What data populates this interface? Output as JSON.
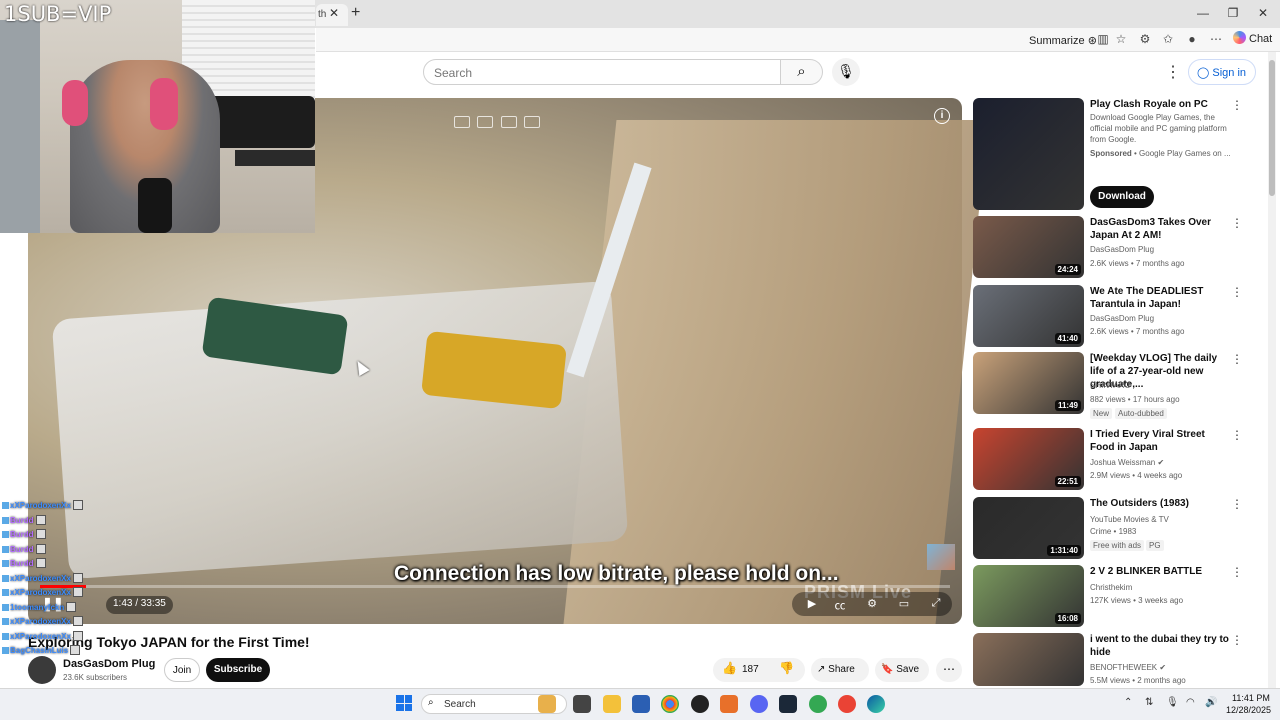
{
  "stream_overlay": {
    "label": "1SUB=VIP"
  },
  "browser": {
    "tab_partial_title": "th",
    "summarize_label": "Summarize",
    "chat_label": "Chat"
  },
  "header": {
    "search_placeholder": "Search",
    "signin_label": "Sign in"
  },
  "player": {
    "subtitle": "Connection has low bitrate, please hold on...",
    "watermark": "PRISM Live",
    "time": "1:43 / 33:35",
    "progress": 0.051
  },
  "video": {
    "title": "Exploring Tokyo JAPAN for the First Time!",
    "channel_name": "DasGasDom Plug",
    "subscribers": "23.6K subscribers",
    "join_label": "Join",
    "subscribe_label": "Subscribe",
    "like_count": "187",
    "share_label": "Share",
    "save_label": "Save"
  },
  "recommendations": [
    {
      "title": "Play Clash Royale on PC",
      "description": "Download Google Play Games, the official mobile and PC gaming platform from Google.",
      "sponsored": "Sponsored",
      "sponsor_channel": "Google Play Games on ...",
      "cta": "Download",
      "thumb_color": "#1b1f2e"
    },
    {
      "title": "DasGasDom3 Takes Over Japan At 2 AM!",
      "channel": "DasGasDom Plug",
      "meta": "2.6K views • 7 months ago",
      "duration": "24:24",
      "thumb_color": "#7a5a4a"
    },
    {
      "title": "We Ate The DEADLIEST Tarantula in Japan!",
      "channel": "DasGasDom Plug",
      "meta": "2.6K views • 7 months ago",
      "duration": "41:40",
      "thumb_color": "#6a6f78"
    },
    {
      "title": "[Weekday VLOG] The daily life of a 27-year-old new graduate,...",
      "channel": "SHINTARO",
      "meta": "882 views • 17 hours ago",
      "badge_new": "New",
      "badge_dub": "Auto-dubbed",
      "duration": "11:49",
      "thumb_color": "#c9a27a"
    },
    {
      "title": "I Tried Every Viral Street Food in Japan",
      "channel": "Joshua Weissman",
      "meta": "2.9M views • 4 weeks ago",
      "duration": "22:51",
      "thumb_color": "#c8442f"
    },
    {
      "title": "The Outsiders (1983)",
      "channel": "YouTube Movies & TV",
      "meta": "Crime • 1983",
      "badge_ads": "Free with ads",
      "badge_rating": "PG",
      "duration": "1:31:40",
      "thumb_color": "#2a2a2a"
    },
    {
      "title": "2 V 2 BLINKER BATTLE",
      "channel": "Christhekim",
      "meta": "127K views • 3 weeks ago",
      "duration": "16:08",
      "thumb_color": "#7b9a5e"
    },
    {
      "title": "i went to the dubai they try to hide",
      "channel": "BENOFTHEWEEK",
      "meta": "5.5M views • 2 months ago",
      "thumb_color": "#8a6f5a"
    }
  ],
  "stream_chat": [
    {
      "user": "xXParodoxenXx",
      "color": "#3b8cff"
    },
    {
      "user": "Burdd",
      "color": "#b36cff"
    },
    {
      "user": "Burdd",
      "color": "#b36cff"
    },
    {
      "user": "Burdd",
      "color": "#b36cff"
    },
    {
      "user": "Burdd",
      "color": "#b36cff"
    },
    {
      "user": "xXParodoxenXx",
      "color": "#3b8cff"
    },
    {
      "user": "xXParodoxenXx",
      "color": "#3b8cff"
    },
    {
      "user": "1toomanyfckn",
      "color": "#3b8cff"
    },
    {
      "user": "xXParodoxenXx",
      "color": "#3b8cff"
    },
    {
      "user": "xXParodoxenXx",
      "color": "#3b8cff"
    },
    {
      "user": "BagChasinLuis",
      "color": "#3b8cff"
    }
  ],
  "taskbar": {
    "search_label": "Search",
    "time": "11:41 PM",
    "date": "12/28/2025"
  }
}
